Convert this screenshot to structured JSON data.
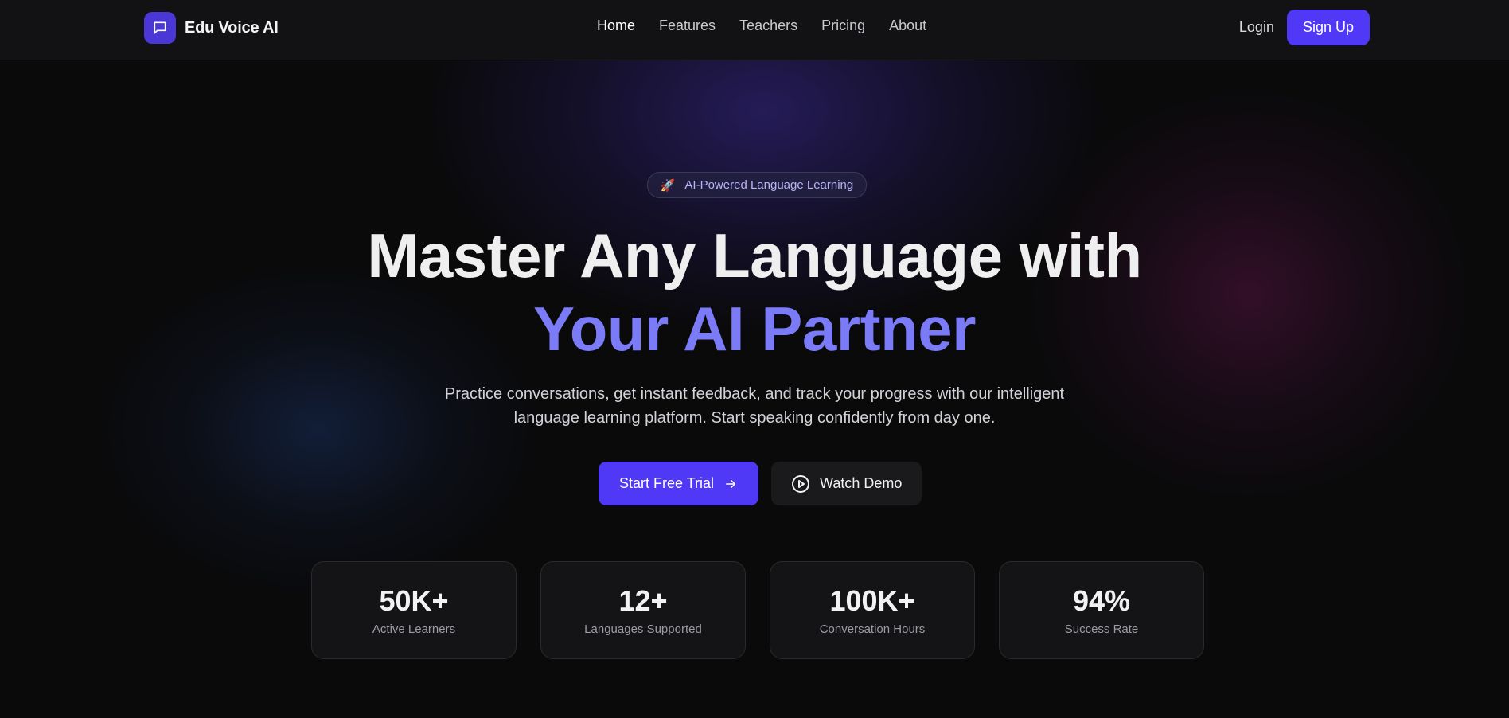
{
  "brand": {
    "name": "Edu Voice AI",
    "logo_icon": "chat-bubble-icon",
    "accent": "#4f39f6"
  },
  "nav": {
    "links": [
      "Home",
      "Features",
      "Teachers",
      "Pricing",
      "About"
    ],
    "active": "Home",
    "login_label": "Login",
    "signup_label": "Sign Up"
  },
  "hero": {
    "badge_icon": "🚀",
    "badge_text": "AI-Powered Language Learning",
    "headline_line1": "Master Any Language with",
    "headline_line2": "Your AI Partner",
    "headline_accent": "#7b7bf7",
    "subtitle": "Practice conversations, get instant feedback, and track your progress with our intelligent language learning platform. Start speaking confidently from day one.",
    "primary_cta": "Start Free Trial",
    "primary_cta_icon": "arrow-right-icon",
    "secondary_cta": "Watch Demo",
    "secondary_cta_icon": "play-circle-icon"
  },
  "stats": [
    {
      "value": "50K+",
      "label": "Active Learners"
    },
    {
      "value": "12+",
      "label": "Languages Supported"
    },
    {
      "value": "100K+",
      "label": "Conversation Hours"
    },
    {
      "value": "94%",
      "label": "Success Rate"
    }
  ]
}
